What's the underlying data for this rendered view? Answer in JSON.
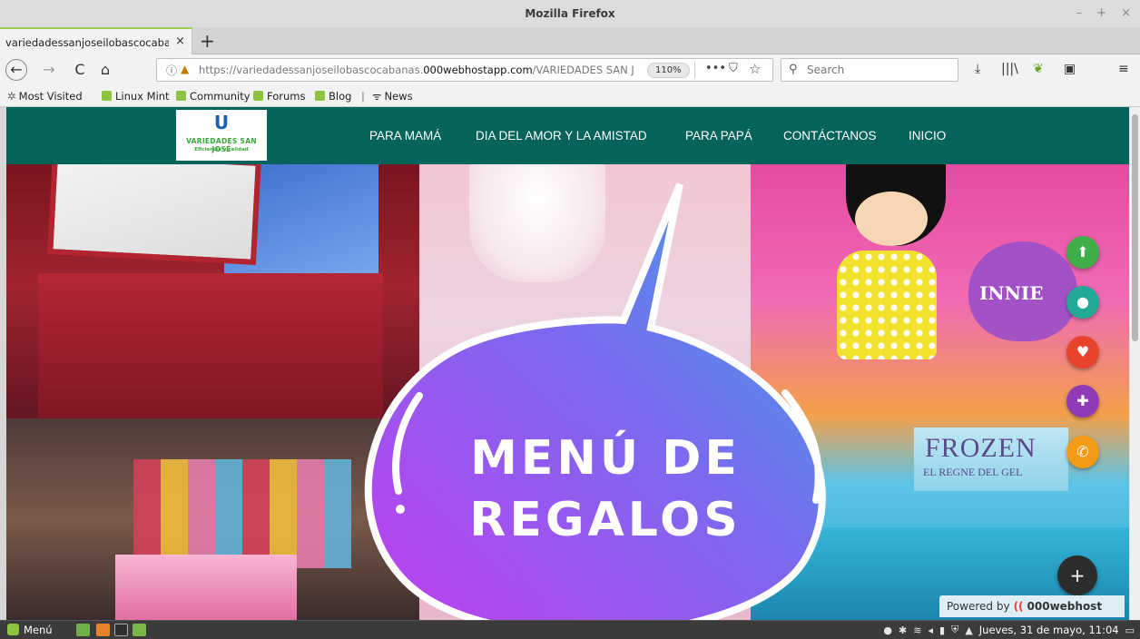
{
  "window": {
    "title": "Mozilla Firefox",
    "controls": [
      "–",
      "+",
      "×"
    ]
  },
  "tabs": [
    {
      "title": "variedadessanjoseilobascocabar",
      "close": "×"
    }
  ],
  "new_tab": "+",
  "nav": {
    "back": "←",
    "forward": "→",
    "reload": "C",
    "home": "⌂",
    "url_prefix": "https://variedadessanjoseilobascocabanas.",
    "url_domain": "000webhostapp.com",
    "url_path": "/VARIEDADES SAN JOSÉ/\\",
    "zoom": "110%",
    "page_actions": "•••",
    "pocket": "⛉",
    "bookmark_star": "☆",
    "search_placeholder": "Search",
    "toolbar_icons": [
      "⤓",
      "|||\\",
      "❦",
      "▣",
      "≡"
    ]
  },
  "bookmarks": [
    {
      "label": "Most Visited",
      "icon": "star-icon"
    },
    {
      "label": "Linux Mint",
      "icon": "mint-icon"
    },
    {
      "label": "Community",
      "icon": "mint-icon"
    },
    {
      "label": "Forums",
      "icon": "mint-icon"
    },
    {
      "label": "Blog",
      "icon": "mint-icon"
    },
    {
      "label": "News",
      "icon": "rss-icon"
    }
  ],
  "site": {
    "logo": {
      "mark": "U",
      "name": "VARIEDADES SAN JOSÉ",
      "tagline": "Eficiencia y calidad"
    },
    "menu": [
      "PARA MAMÁ",
      "DIA DEL AMOR Y LA AMISTAD",
      "PARA PAPÁ",
      "CONTÁCTANOS",
      "INICIO"
    ],
    "hero": {
      "line1": "MENÚ DE",
      "line2": "REGALOS",
      "photo_text_innie": "INNIE",
      "photo_text_frozen": "FROZEN",
      "photo_text_regne": "EL REGNE DEL GEL"
    },
    "fabs": [
      {
        "name": "upload",
        "glyph": "⬆",
        "color": "#3fae49"
      },
      {
        "name": "profile",
        "glyph": "●",
        "color": "#22a996"
      },
      {
        "name": "favorite",
        "glyph": "♥",
        "color": "#e8432b"
      },
      {
        "name": "apps",
        "glyph": "✚",
        "color": "#8e3bb7"
      },
      {
        "name": "phone",
        "glyph": "✆",
        "color": "#f39a16"
      }
    ],
    "fab_main": "+",
    "powered_by": "Powered by",
    "powered_brand": "000webhost"
  },
  "taskbar": {
    "menu_label": "Menú",
    "datetime": "Jueves, 31 de mayo, 11:04"
  },
  "colors": {
    "header_teal": "#05645a",
    "bubble_start": "#c23df0",
    "bubble_end": "#3aa8e6",
    "tab_accent": "#9cc75a"
  }
}
